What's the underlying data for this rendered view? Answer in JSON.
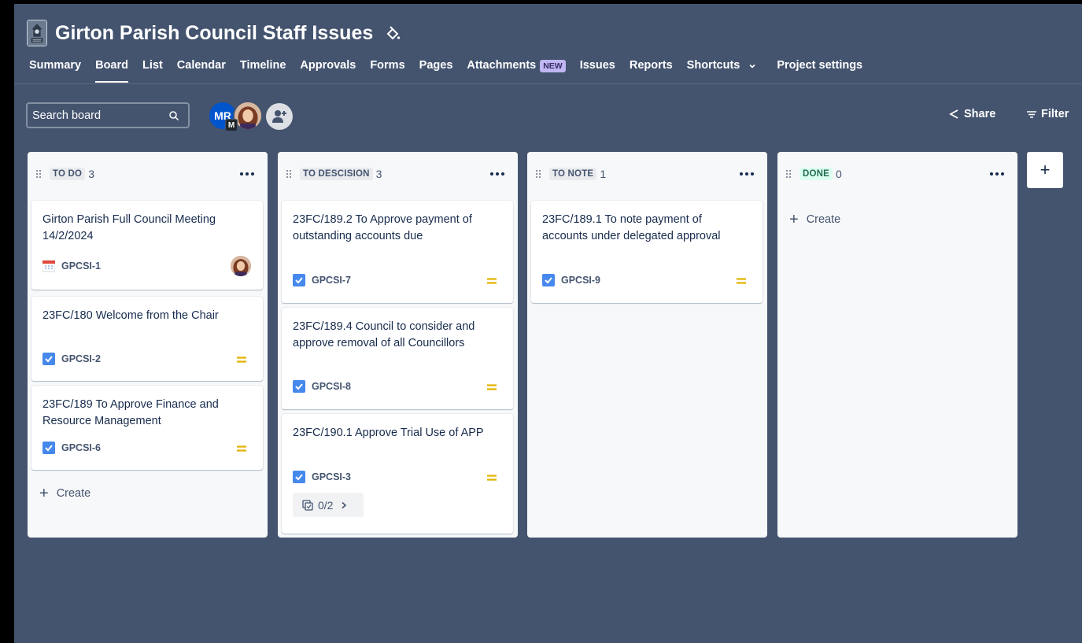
{
  "project": {
    "title": "Girton Parish Council Staff Issues"
  },
  "nav": {
    "tabs": [
      {
        "label": "Summary",
        "active": false
      },
      {
        "label": "Board",
        "active": true
      },
      {
        "label": "List",
        "active": false
      },
      {
        "label": "Calendar",
        "active": false
      },
      {
        "label": "Timeline",
        "active": false
      },
      {
        "label": "Approvals",
        "active": false
      },
      {
        "label": "Forms",
        "active": false
      },
      {
        "label": "Pages",
        "active": false
      },
      {
        "label": "Attachments",
        "active": false,
        "badge": "NEW"
      },
      {
        "label": "Issues",
        "active": false
      },
      {
        "label": "Reports",
        "active": false
      },
      {
        "label": "Shortcuts",
        "active": false,
        "dropdown": true
      },
      {
        "label": "Project settings",
        "active": false
      }
    ]
  },
  "toolbar": {
    "search_placeholder": "Search board",
    "avatar_initials": "MR",
    "avatar_sub": "M",
    "share_label": "Share",
    "filter_label": "Filter"
  },
  "columns": [
    {
      "name": "TO DO",
      "count": "3",
      "cards": [
        {
          "title": "Girton Parish Full Council Meeting 14/2/2024",
          "key": "GPCSI-1",
          "type": "calendar-icon",
          "assignee": true,
          "priority": false
        },
        {
          "title": "23FC/180 Welcome from the Chair",
          "key": "GPCSI-2",
          "type": "checkbox-icon",
          "priority": true
        },
        {
          "title": "23FC/189 To Approve Finance and Resource Management",
          "key": "GPCSI-6",
          "type": "checkbox-icon",
          "priority": true
        }
      ],
      "create_label": "Create"
    },
    {
      "name": "TO DESCISION",
      "count": "3",
      "cards": [
        {
          "title": "23FC/189.2 To Approve payment of outstanding accounts due",
          "key": "GPCSI-7",
          "type": "checkbox-icon",
          "priority": true
        },
        {
          "title": "23FC/189.4 Council to consider and approve removal of all Councillors",
          "key": "GPCSI-8",
          "type": "checkbox-icon",
          "priority": true
        },
        {
          "title": "23FC/190.1 Approve Trial Use of APP",
          "key": "GPCSI-3",
          "type": "checkbox-icon",
          "priority": true,
          "subtasks": "0/2"
        }
      ]
    },
    {
      "name": "TO NOTE",
      "count": "1",
      "cards": [
        {
          "title": "23FC/189.1 To note payment of accounts under delegated approval",
          "key": "GPCSI-9",
          "type": "checkbox-icon",
          "priority": true
        }
      ]
    },
    {
      "name": "DONE",
      "count": "0",
      "cards": [],
      "create_label": "Create"
    }
  ],
  "add_column_label": "+",
  "colors": {
    "background": "#44546f",
    "column": "#f7f8f9",
    "card": "#ffffff",
    "checkbox": "#4688ec",
    "priority_medium": "#e2b203",
    "done_lozenge": "#216e4e"
  }
}
